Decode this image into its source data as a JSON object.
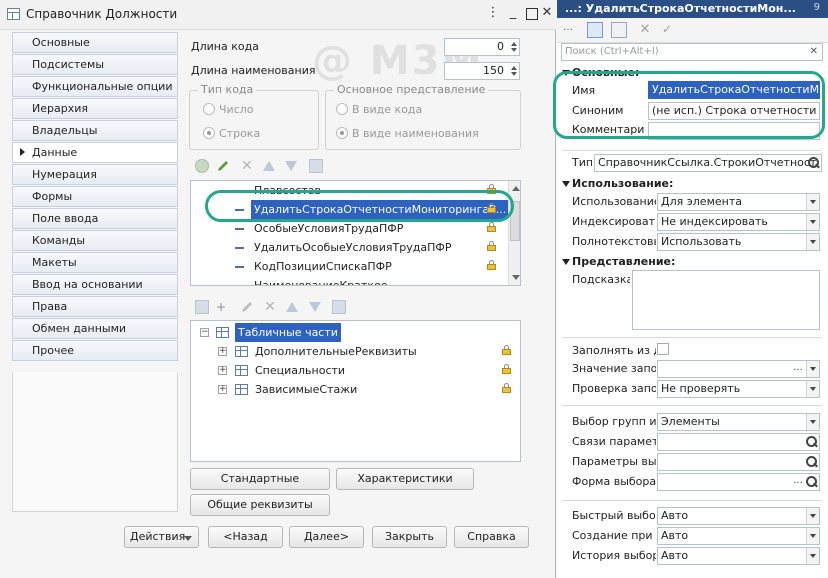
{
  "left_window": {
    "title": "Справочник Должности",
    "nav": [
      {
        "label": "Основные"
      },
      {
        "label": "Подсистемы"
      },
      {
        "label": "Функциональные опции"
      },
      {
        "label": "Иерархия"
      },
      {
        "label": "Владельцы"
      },
      {
        "label": "Данные",
        "active": true
      },
      {
        "label": "Нумерация"
      },
      {
        "label": "Формы"
      },
      {
        "label": "Поле ввода"
      },
      {
        "label": "Команды"
      },
      {
        "label": "Макеты"
      },
      {
        "label": "Ввод на основании"
      },
      {
        "label": "Права"
      },
      {
        "label": "Обмен данными"
      },
      {
        "label": "Прочее"
      }
    ],
    "code_length_label": "Длина кода",
    "code_length_value": "0",
    "name_length_label": "Длина наименования",
    "name_length_value": "150",
    "code_type": {
      "title": "Тип кода",
      "number": "Число",
      "string": "Строка"
    },
    "main_repr": {
      "title": "Основное представление",
      "as_code": "В виде кода",
      "as_name": "В виде наименования"
    },
    "attributes": [
      "Плавсостав",
      "УдалитьСтрокаОтчетностиМониторингаР...",
      "ОсобыеУсловияТрудаПФР",
      "УдалитьОсобыеУсловияТрудаПФР",
      "КодПозицииСпискаПФР",
      "НаименованиеКраткое"
    ],
    "tabular_root": "Табличные части",
    "tabular_parts": [
      "ДополнительныеРеквизиты",
      "Специальности",
      "ЗависимыеСтажи"
    ],
    "btn_standard": "Стандартные реквизиты",
    "btn_characteristics": "Характеристики",
    "btn_common": "Общие реквизиты",
    "btn_actions": "Действия",
    "btn_back": "<Назад",
    "btn_next": "Далее>",
    "btn_close": "Закрыть",
    "btn_help": "Справка",
    "watermark": "@ М3М"
  },
  "right_panel": {
    "title": "...: УдалитьСтрокаОтчетностиМон...",
    "title_num": "9",
    "search_placeholder": "Поиск (Ctrl+Alt+I)",
    "sections": {
      "main": "Основные:",
      "usage": "Использование:",
      "presentation": "Представление:"
    },
    "props": {
      "name_label": "Имя",
      "name_value": "УдалитьСтрокаОтчетностиМонит",
      "synonym_label": "Синоним",
      "synonym_value": "(не исп.) Строка отчетности монит",
      "comment_label": "Комментарий",
      "type_label": "Тип",
      "type_value": "СправочникСсылка.СтрокиОтчетност",
      "usage_label": "Использование",
      "usage_value": "Для элемента",
      "index_label": "Индексировать",
      "index_value": "Не индексировать",
      "fulltext_label": "Полнотекстовый",
      "fulltext_value": "Использовать",
      "hint_label": "Подсказка",
      "fill_from_label": "Заполнять из да",
      "fill_value_label": "Значение запол",
      "check_fill_label": "Проверка запол",
      "check_fill_value": "Не проверять",
      "choose_group_label": "Выбор групп и э",
      "choose_group_value": "Элементы",
      "links_label": "Связи параметр",
      "params_label": "Параметры выбо",
      "choice_form_label": "Форма выбора",
      "quick_choice_label": "Быстрый выбор",
      "quick_choice_value": "Авто",
      "create_on_input_label": "Создание при вв",
      "create_on_input_value": "Авто",
      "history_label": "История выбора",
      "history_value": "Авто"
    }
  },
  "colors": {
    "highlight": "#23a88d",
    "selection": "#2d62c1",
    "title_bar": "#2b4f85"
  }
}
